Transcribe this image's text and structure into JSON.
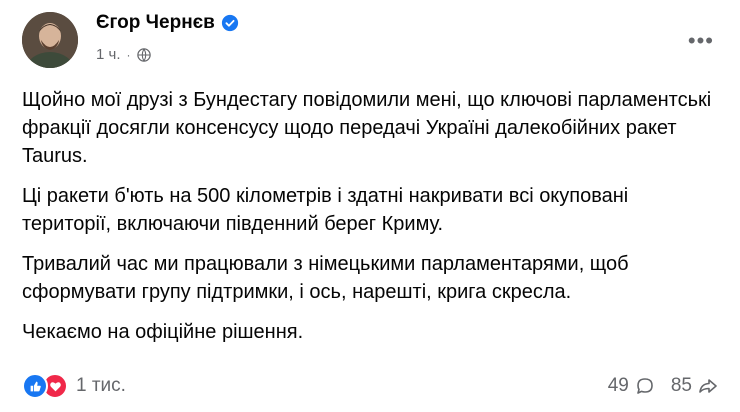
{
  "post": {
    "author": "Єгор Чернєв",
    "time": "1 ч.",
    "time_separator": "·",
    "more_label": "•••",
    "paragraphs": [
      "Щойно мої друзі з Бундестагу повідомили мені, що ключові парламентські фракції досягли консенсусу щодо передачі Україні далекобійних ракет Taurus.",
      "Ці ракети б'ють на 500 кілометрів і здатні накривати всі окуповані території, включаючи південний берег Криму.",
      "Тривалий час ми працювали з німецькими парламентарями, щоб сформувати групу підтримки, і ось, нарешті, крига скресла.",
      "Чекаємо на офіційне рішення."
    ],
    "reactions_count": "1 тис.",
    "comments_count": "49",
    "shares_count": "85"
  },
  "icons": {
    "verified": "verified-badge-icon",
    "globe": "globe-icon",
    "like": "like-icon",
    "love": "love-icon",
    "comment": "comment-icon",
    "share": "share-icon"
  },
  "colors": {
    "accent": "#1877f2",
    "love": "#f02849",
    "secondary_text": "#65676b",
    "primary_text": "#050505"
  }
}
